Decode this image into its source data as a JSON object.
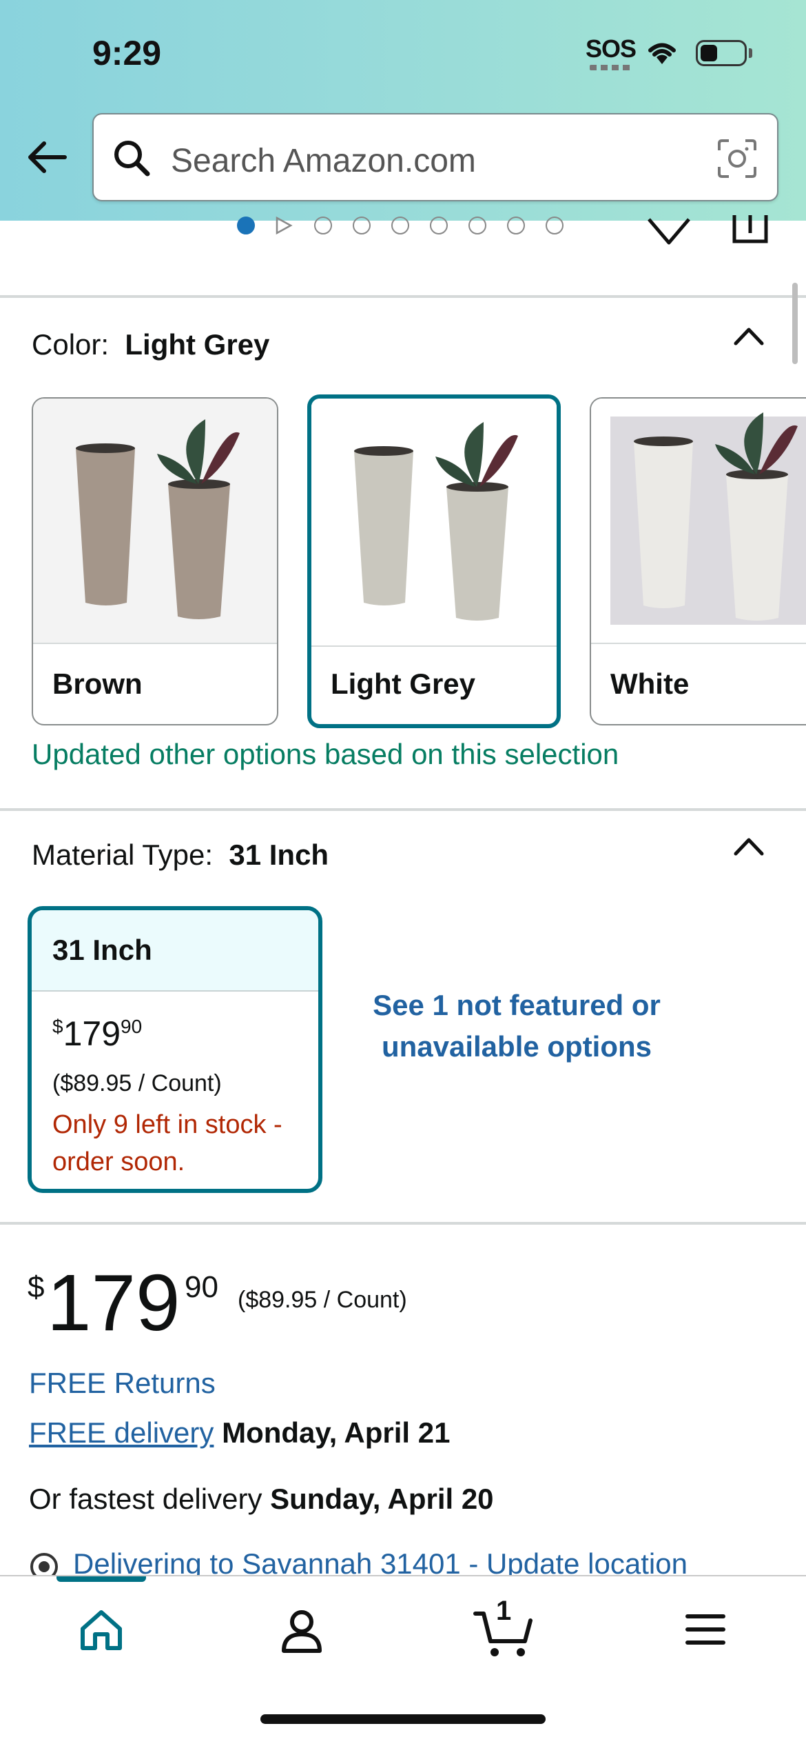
{
  "status_bar": {
    "time": "9:29",
    "sos": "SOS"
  },
  "search": {
    "placeholder": "Search Amazon.com"
  },
  "color_section": {
    "label": "Color:",
    "selected": "Light Grey",
    "options": [
      {
        "label": "Brown",
        "color": "#a4968a"
      },
      {
        "label": "Light Grey",
        "color": "#c9c7be"
      },
      {
        "label": "White",
        "color": "#e6e5e1"
      }
    ],
    "update_note": "Updated other options based on this selection"
  },
  "material_section": {
    "label": "Material Type:",
    "selected": "31 Inch",
    "card": {
      "title": "31 Inch",
      "price_symbol": "$",
      "price_whole": "179",
      "price_fraction": "90",
      "unit_price": "($89.95 / Count)",
      "stock": "Only 9 left in stock - order soon."
    },
    "not_featured": "See 1 not featured or unavailable options"
  },
  "price_section": {
    "symbol": "$",
    "whole": "179",
    "fraction": "90",
    "unit_price": "($89.95 / Count)",
    "free_returns": "FREE Returns",
    "free_delivery_link": "FREE delivery",
    "delivery_date": "Monday, April 21",
    "fastest_prefix": "Or fastest delivery",
    "fastest_date": "Sunday, April 20",
    "location": "Delivering to Savannah 31401 - Update location"
  },
  "bottom_nav": {
    "cart_count": "1"
  },
  "colors": {
    "accent": "#007185",
    "link": "#2162a1",
    "success": "#067d62",
    "warning": "#b12704"
  }
}
